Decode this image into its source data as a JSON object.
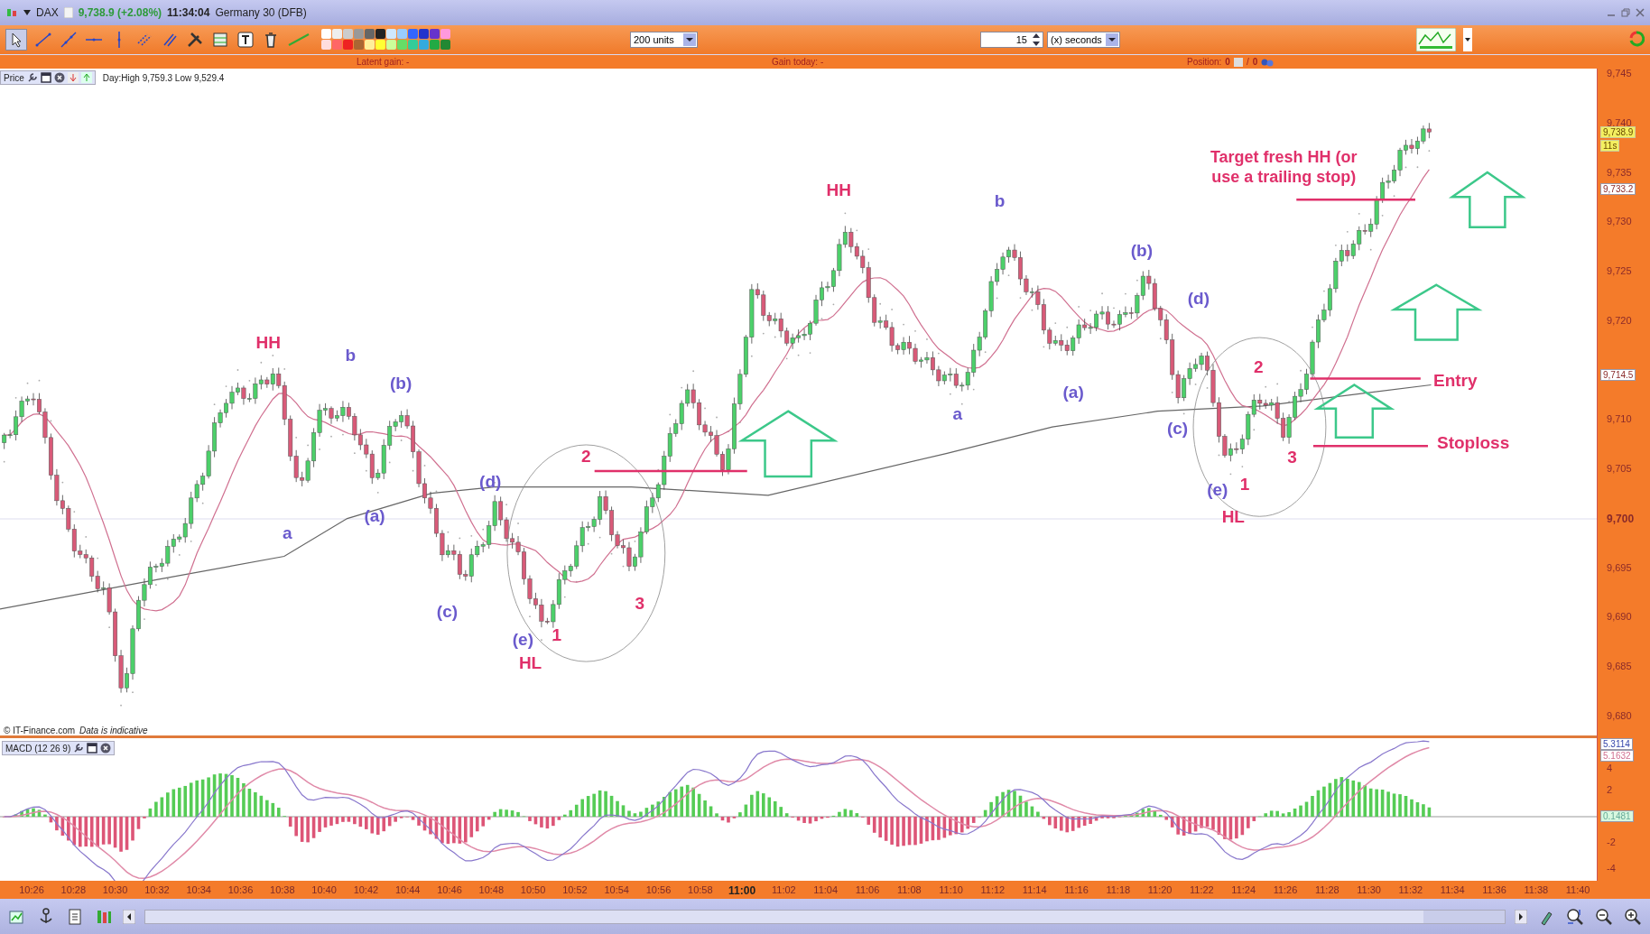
{
  "title_bar": {
    "symbol": "DAX",
    "price": "9,738.9 (+2.08%)",
    "time": "11:34:04",
    "instrument": "Germany 30 (DFB)"
  },
  "toolbar": {
    "units": "200 units",
    "interval": "15",
    "interval_unit": "(x) seconds"
  },
  "info_bar": {
    "latent_gain": "Latent gain: -",
    "gain_today": "Gain today: -",
    "position_label": "Position:",
    "position_long": "0",
    "position_sep": "/",
    "position_short": "0"
  },
  "price_panel": {
    "title": "Price",
    "day_range": "Day:High 9,759.3 Low 9,529.4",
    "ticks": [
      {
        "label": "9,745",
        "major": false
      },
      {
        "label": "9,740",
        "major": false
      },
      {
        "label": "9,735",
        "major": false
      },
      {
        "label": "9,730",
        "major": false
      },
      {
        "label": "9,725",
        "major": false
      },
      {
        "label": "9,720",
        "major": false
      },
      {
        "label": "9,710",
        "major": false
      },
      {
        "label": "9,705",
        "major": false
      },
      {
        "label": "9,700",
        "major": true
      },
      {
        "label": "9,695",
        "major": false
      },
      {
        "label": "9,690",
        "major": false
      },
      {
        "label": "9,685",
        "major": false
      },
      {
        "label": "9,680",
        "major": false
      }
    ],
    "markers": [
      {
        "label": "9,738.9",
        "kind": "last"
      },
      {
        "label": "11s",
        "kind": "timer"
      },
      {
        "label": "9,733.2",
        "kind": "level"
      },
      {
        "label": "9,714.5",
        "kind": "level"
      }
    ],
    "copyright": "© IT-Finance.com",
    "disclaimer": "Data is indicative",
    "annotations": [
      {
        "text": "HH",
        "color": "#e0306a"
      },
      {
        "text": "b",
        "color": "#6a5acd"
      },
      {
        "text": "(b)",
        "color": "#6a5acd"
      },
      {
        "text": "a",
        "color": "#6a5acd"
      },
      {
        "text": "(a)",
        "color": "#6a5acd"
      },
      {
        "text": "(d)",
        "color": "#6a5acd"
      },
      {
        "text": "(c)",
        "color": "#6a5acd"
      },
      {
        "text": "(e)",
        "color": "#6a5acd"
      },
      {
        "text": "HL",
        "color": "#e0306a"
      },
      {
        "text": "1",
        "color": "#e0306a"
      },
      {
        "text": "2",
        "color": "#e0306a"
      },
      {
        "text": "3",
        "color": "#e0306a"
      },
      {
        "text": "HH",
        "color": "#e0306a"
      },
      {
        "text": "b",
        "color": "#6a5acd"
      },
      {
        "text": "a",
        "color": "#6a5acd"
      },
      {
        "text": "(a)",
        "color": "#6a5acd"
      },
      {
        "text": "(b)",
        "color": "#6a5acd"
      },
      {
        "text": "(d)",
        "color": "#6a5acd"
      },
      {
        "text": "(c)",
        "color": "#6a5acd"
      },
      {
        "text": "(e)",
        "color": "#6a5acd"
      },
      {
        "text": "1",
        "color": "#e0306a"
      },
      {
        "text": "HL",
        "color": "#e0306a"
      },
      {
        "text": "2",
        "color": "#e0306a"
      },
      {
        "text": "3",
        "color": "#e0306a"
      },
      {
        "text": "Target fresh HH (or use a trailing stop)",
        "color": "#e0306a"
      },
      {
        "text": "Entry",
        "color": "#e0306a"
      },
      {
        "text": "Stoploss",
        "color": "#e0306a"
      }
    ]
  },
  "macd_panel": {
    "title": "MACD (12 26 9)",
    "ticks": [
      "4",
      "2",
      "-2",
      "-4"
    ],
    "markers": [
      {
        "label": "5.3114",
        "kind": "macd"
      },
      {
        "label": "5.1632",
        "kind": "signal"
      },
      {
        "label": "0.1481",
        "kind": "histogram"
      }
    ]
  },
  "time_axis": [
    {
      "label": "10:26",
      "major": false
    },
    {
      "label": "10:28",
      "major": false
    },
    {
      "label": "10:30",
      "major": false
    },
    {
      "label": "10:32",
      "major": false
    },
    {
      "label": "10:34",
      "major": false
    },
    {
      "label": "10:36",
      "major": false
    },
    {
      "label": "10:38",
      "major": false
    },
    {
      "label": "10:40",
      "major": false
    },
    {
      "label": "10:42",
      "major": false
    },
    {
      "label": "10:44",
      "major": false
    },
    {
      "label": "10:46",
      "major": false
    },
    {
      "label": "10:48",
      "major": false
    },
    {
      "label": "10:50",
      "major": false
    },
    {
      "label": "10:52",
      "major": false
    },
    {
      "label": "10:54",
      "major": false
    },
    {
      "label": "10:56",
      "major": false
    },
    {
      "label": "10:58",
      "major": false
    },
    {
      "label": "11:00",
      "major": true
    },
    {
      "label": "11:02",
      "major": false
    },
    {
      "label": "11:04",
      "major": false
    },
    {
      "label": "11:06",
      "major": false
    },
    {
      "label": "11:08",
      "major": false
    },
    {
      "label": "11:10",
      "major": false
    },
    {
      "label": "11:12",
      "major": false
    },
    {
      "label": "11:14",
      "major": false
    },
    {
      "label": "11:16",
      "major": false
    },
    {
      "label": "11:18",
      "major": false
    },
    {
      "label": "11:20",
      "major": false
    },
    {
      "label": "11:22",
      "major": false
    },
    {
      "label": "11:24",
      "major": false
    },
    {
      "label": "11:26",
      "major": false
    },
    {
      "label": "11:28",
      "major": false
    },
    {
      "label": "11:30",
      "major": false
    },
    {
      "label": "11:32",
      "major": false
    },
    {
      "label": "11:34",
      "major": false
    },
    {
      "label": "11:36",
      "major": false
    },
    {
      "label": "11:38",
      "major": false
    },
    {
      "label": "11:40",
      "major": false
    }
  ]
}
